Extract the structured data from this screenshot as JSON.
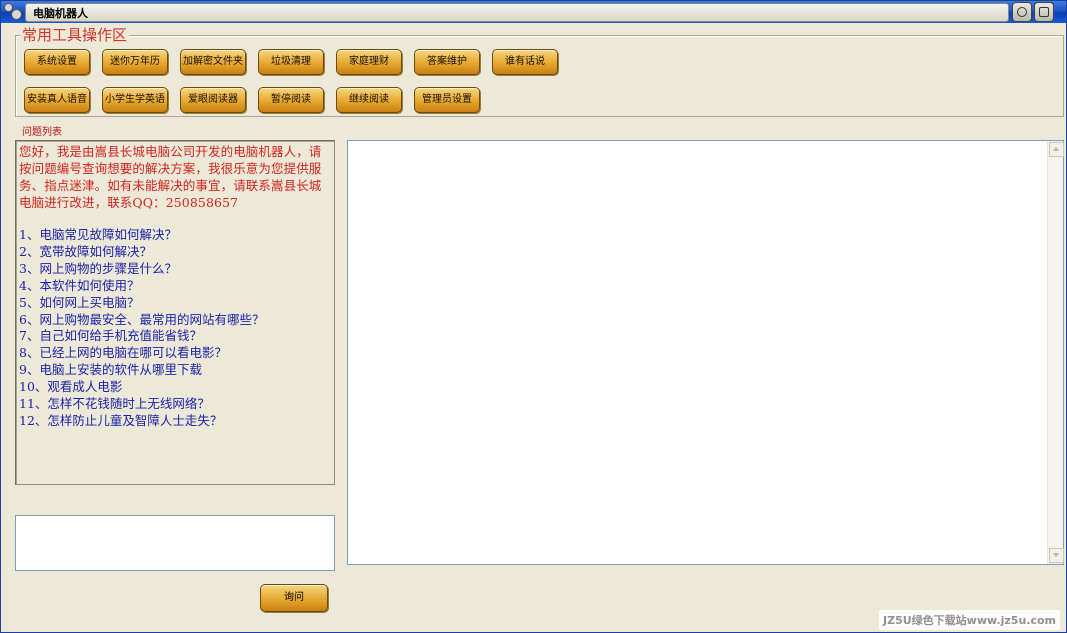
{
  "window": {
    "title": "电脑机器人"
  },
  "toolbox": {
    "title": "常用工具操作区",
    "row1": [
      "系统设置",
      "迷你万年历",
      "加解密文件夹",
      "垃圾清理",
      "家庭理财",
      "答案维护",
      "谁有话说"
    ],
    "row2": [
      "安装真人语音",
      "小学生学英语",
      "爱眼阅读器",
      "暂停阅读",
      "继续阅读",
      "管理员设置"
    ]
  },
  "questions": {
    "section_label": "问题列表",
    "intro": "您好，我是由嵩县长城电脑公司开发的电脑机器人，请按问题编号查询想要的解决方案，我很乐意为您提供服务、指点迷津。如有未能解决的事宜，请联系嵩县长城电脑进行改进，联系QQ：250858657",
    "items": [
      "1、电脑常见故障如何解决？",
      "2、宽带故障如何解决？",
      "3、网上购物的步骤是什么？",
      "4、本软件如何使用？",
      "5、如何网上买电脑？",
      "6、网上购物最安全、最常用的网站有哪些？",
      "7、自己如何给手机充值能省钱？",
      "8、已经上网的电脑在哪可以看电影？",
      "9、电脑上安装的软件从哪里下载",
      "10、观看成人电影",
      "11、怎样不花钱随时上无线网络？",
      "12、怎样防止儿童及智障人士走失？"
    ]
  },
  "input": {
    "value": ""
  },
  "ask_button": {
    "label": "询问"
  },
  "watermark": "JZ5U绿色下载站www.jz5u.com",
  "colors": {
    "intro_text": "#d32420",
    "question_text": "#1b22a8",
    "button_orange": "#e6a82e"
  }
}
